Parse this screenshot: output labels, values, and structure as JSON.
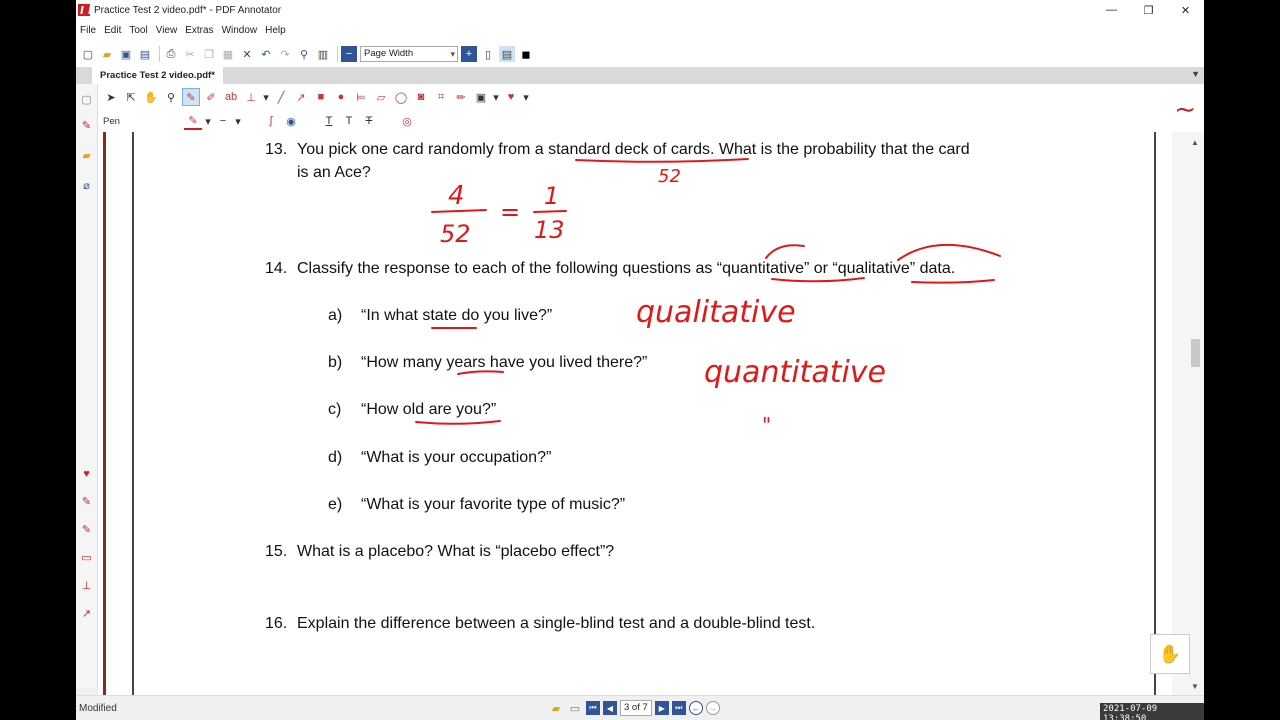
{
  "window": {
    "title": "Practice Test 2 video.pdf* - PDF Annotator",
    "minimize": "—",
    "maximize": "❐",
    "close": "✕"
  },
  "menu": [
    "File",
    "Edit",
    "Tool",
    "View",
    "Extras",
    "Window",
    "Help"
  ],
  "toolbar": {
    "zoom": "Page Width"
  },
  "tab": {
    "label": "Practice Test 2 video.pdf*"
  },
  "annotation_toolbar": {
    "tool_label": "Pen",
    "accent": "#d01e1e"
  },
  "document": {
    "q13": {
      "num": "13.",
      "line1_pre": "You pick one card randomly from a ",
      "line1_underlined": "standard deck of cards",
      "line1_post": ". What is the probability that the card",
      "line2": "is an Ace?"
    },
    "q14": {
      "num": "14.",
      "text_pre": "Classify the response to each of the following questions as “",
      "word1": "quantitative",
      "text_mid": "” or “",
      "word2": "qualitative",
      "text_post": "” data."
    },
    "parts": [
      {
        "label": "a)",
        "text": "“In what state do you live?”"
      },
      {
        "label": "b)",
        "text": "“How many years have you lived there?”"
      },
      {
        "label": "c)",
        "text": "“How old are you?”"
      },
      {
        "label": "d)",
        "text": "“What is your occupation?”"
      },
      {
        "label": "e)",
        "text": "“What is your favorite type of music?”"
      }
    ],
    "q15": {
      "num": "15.",
      "text": "What is a placebo? What is “placebo effect”?"
    },
    "q16": {
      "num": "16.",
      "text": "Explain the difference between a single-blind test and a double-blind test."
    },
    "handwriting": {
      "deck_count": "52",
      "fraction1_num": "4",
      "fraction1_den": "52",
      "equals": "=",
      "fraction2_num": "1",
      "fraction2_den": "13",
      "answer_a": "qualitative",
      "answer_b": "quantitative",
      "answer_c": "\""
    }
  },
  "statusbar": {
    "status": "Modified",
    "page_field": "3 of 7",
    "timestamp": "2021-07-09 13:38:50"
  }
}
